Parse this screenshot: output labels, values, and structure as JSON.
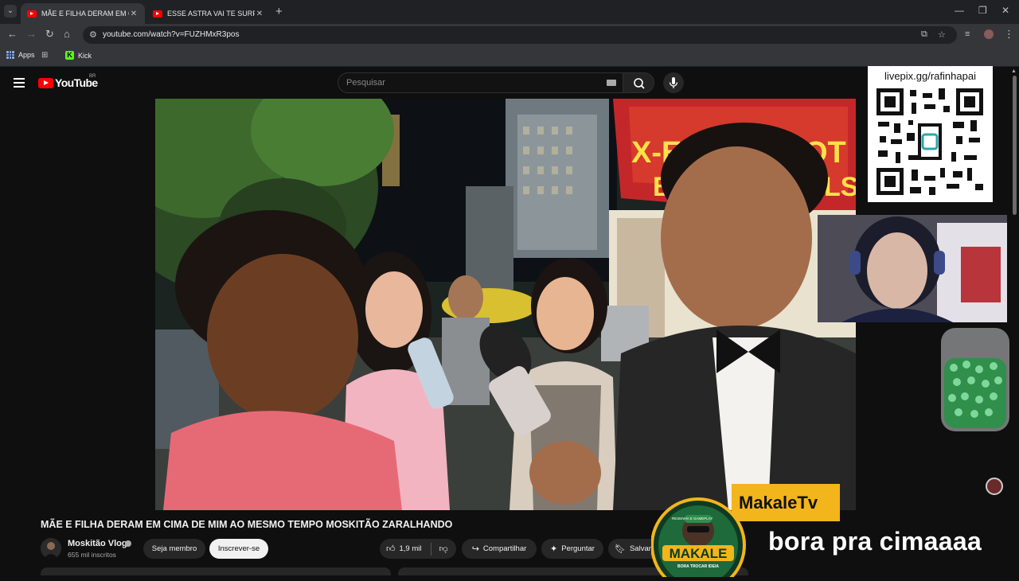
{
  "browser": {
    "tabs": [
      {
        "title": "MÃE E FILHA DERAM EM CIMA",
        "active": true
      },
      {
        "title": "ESSE ASTRA VAI TE SURPREENDER",
        "active": false
      }
    ],
    "new_tab_glyph": "+",
    "url": "youtube.com/watch?v=FUZHMxR3pos",
    "bookmarks": [
      {
        "label": "Apps",
        "icon": "apps-grid-icon"
      },
      {
        "label": "Kick",
        "icon": "kick-logo-icon"
      }
    ]
  },
  "youtube": {
    "logo_text": "YouTube",
    "country_code": "BR",
    "search_placeholder": "Pesquisar"
  },
  "video": {
    "title": "MÃE E FILHA DERAM EM CIMA DE MIM AO MESMO TEMPO MOSKITÃO ZARALHANDO",
    "channel_name": "Moskitão Vlog",
    "subscribers": "655 mil inscritos",
    "actions": {
      "member": "Seja membro",
      "subscribe": "Inscrever-se",
      "likes": "1,9 mil",
      "share": "Compartilhar",
      "ask": "Perguntar",
      "save": "Salvar"
    },
    "scene_sign_text": [
      "X-E",
      "BU",
      "OT",
      "LS"
    ]
  },
  "stream_overlay": {
    "pix_link": "livepix.gg/rafinhapai",
    "brand_name": "MakaleTv",
    "badge_text": "MAKALE",
    "badge_top_text": "RESENHA E GAMEPLAY",
    "badge_bottom_text": "BORA TROCAR IDEIA",
    "caption": "bora pra cimaaaa"
  },
  "colors": {
    "youtube_red": "#ff0000",
    "brand_yellow": "#f2b51b",
    "kick_green": "#53fc18",
    "page_bg": "#0f0f0f"
  }
}
